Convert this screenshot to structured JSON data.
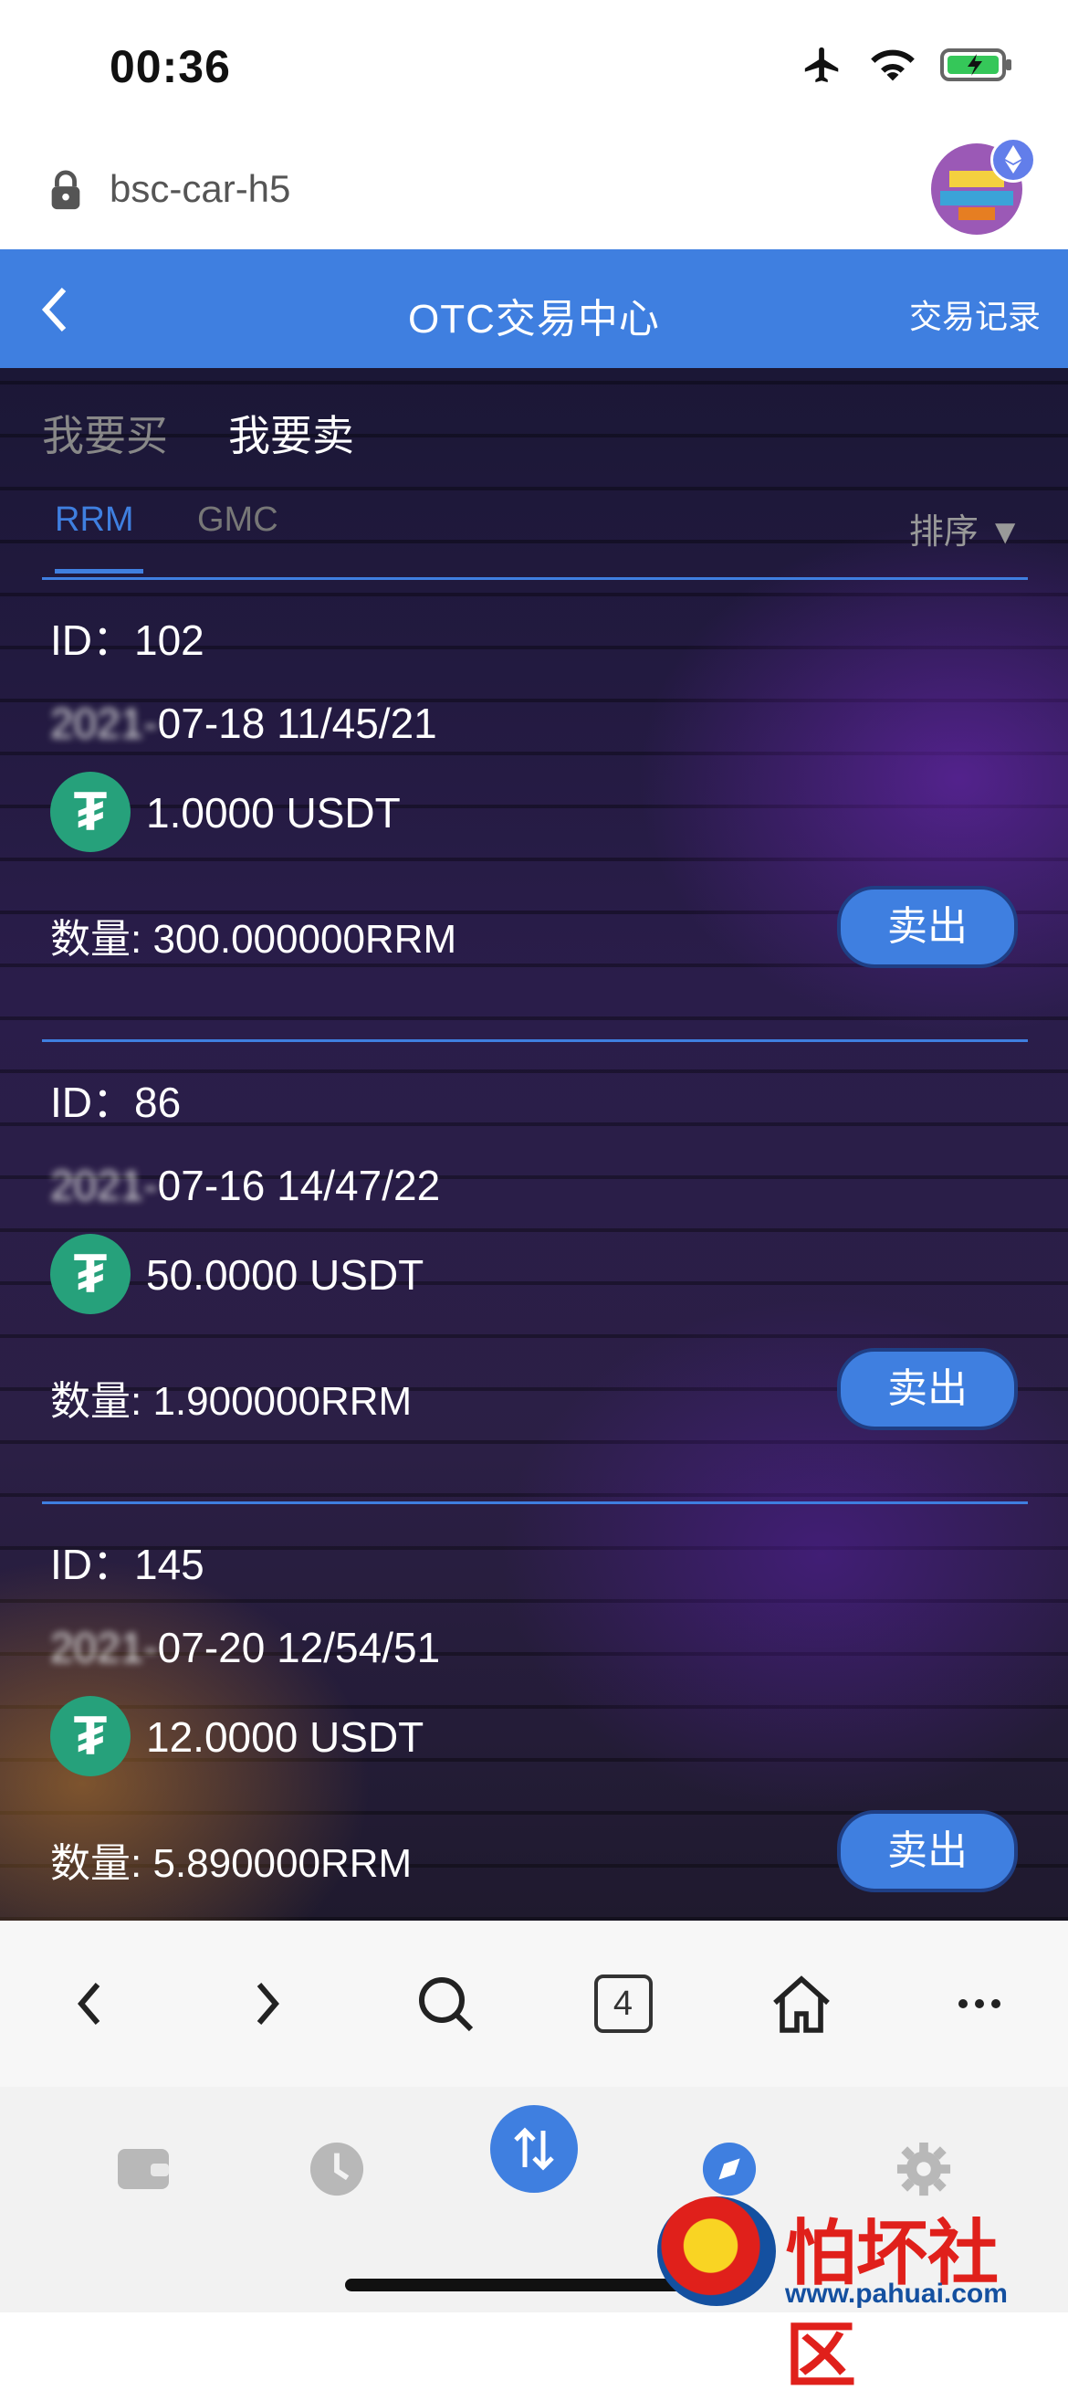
{
  "status_bar": {
    "time": "00:36"
  },
  "browser": {
    "url": "bsc-car-h5",
    "tab_count": "4"
  },
  "header": {
    "back": "<",
    "title": "OTC交易中心",
    "right_link": "交易记录"
  },
  "tabs": {
    "buy": "我要买",
    "sell": "我要卖",
    "active": "sell"
  },
  "subtabs": {
    "rrm": "RRM",
    "gmc": "GMC",
    "active": "RRM",
    "sort": "排序 ▼"
  },
  "orders": [
    {
      "id": "ID：102",
      "date_hidden": "2021-",
      "date": "07-18 11/45/21",
      "price": "1.0000 USDT",
      "qty": "数量: 300.000000RRM",
      "action": "卖出"
    },
    {
      "id": "ID：86",
      "date_hidden": "2021-",
      "date": "07-16 14/47/22",
      "price": "50.0000 USDT",
      "qty": "数量: 1.900000RRM",
      "action": "卖出"
    },
    {
      "id": "ID：145",
      "date_hidden": "2021-",
      "date": "07-20 12/54/51",
      "price": "12.0000 USDT",
      "qty": "数量: 5.890000RRM",
      "action": "卖出"
    }
  ],
  "watermark": {
    "text": "怕坏社区",
    "url": "www.pahuai.com"
  },
  "colors": {
    "primary": "#3f7fe0",
    "usdt": "#26a17b"
  }
}
